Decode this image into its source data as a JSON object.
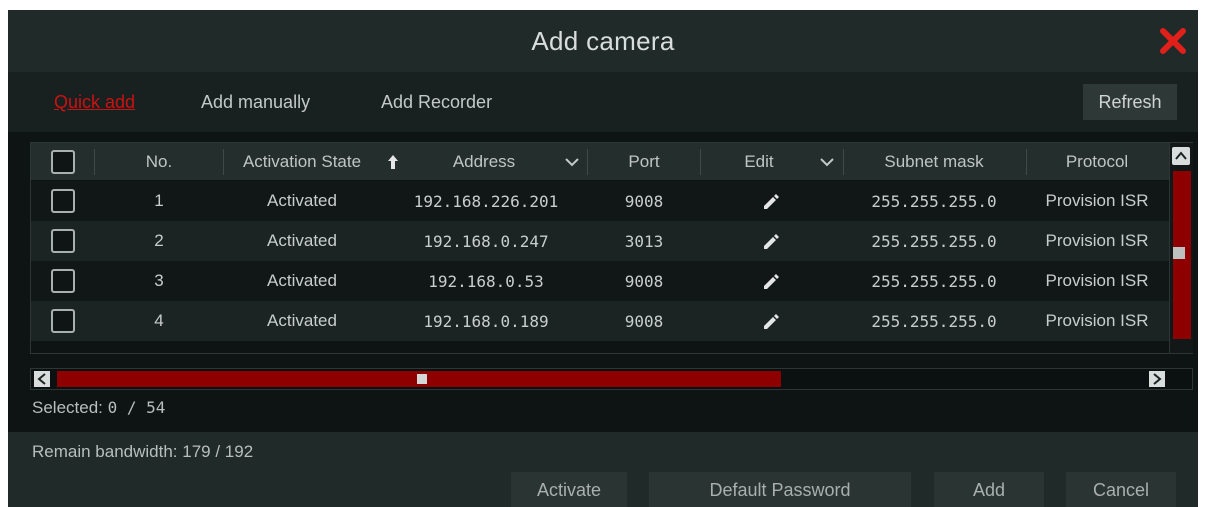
{
  "dialog": {
    "title": "Add camera",
    "close_icon": "close-x-icon",
    "accent_color": "#e0201a"
  },
  "tabs": {
    "quick_add": "Quick add",
    "add_manually": "Add manually",
    "add_recorder": "Add Recorder",
    "refresh": "Refresh"
  },
  "table": {
    "headers": {
      "no": "No.",
      "activation_state": "Activation State",
      "address": "Address",
      "port": "Port",
      "edit": "Edit",
      "subnet_mask": "Subnet mask",
      "protocol": "Protocol"
    },
    "rows": [
      {
        "no": "1",
        "state": "Activated",
        "address": "192.168.226.201",
        "port": "9008",
        "subnet": "255.255.255.0",
        "protocol": "Provision ISR"
      },
      {
        "no": "2",
        "state": "Activated",
        "address": "192.168.0.247",
        "port": "3013",
        "subnet": "255.255.255.0",
        "protocol": "Provision ISR"
      },
      {
        "no": "3",
        "state": "Activated",
        "address": "192.168.0.53",
        "port": "9008",
        "subnet": "255.255.255.0",
        "protocol": "Provision ISR"
      },
      {
        "no": "4",
        "state": "Activated",
        "address": "192.168.0.189",
        "port": "9008",
        "subnet": "255.255.255.0",
        "protocol": "Provision ISR"
      }
    ]
  },
  "status": {
    "selected_label": "Selected: ",
    "selected_value": "0 / 54",
    "bandwidth": "Remain bandwidth: 179 / 192"
  },
  "buttons": {
    "activate": "Activate",
    "default_password": "Default Password",
    "add": "Add",
    "cancel": "Cancel"
  }
}
